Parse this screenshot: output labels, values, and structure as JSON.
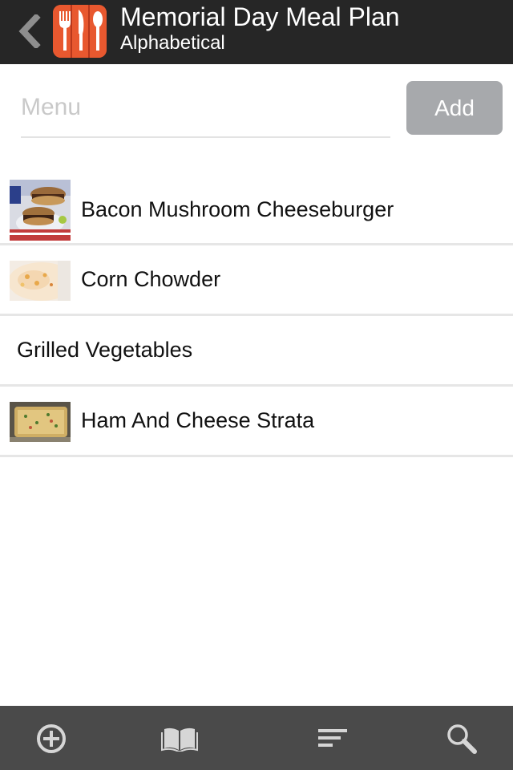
{
  "header": {
    "title": "Memorial Day Meal Plan",
    "subtitle": "Alphabetical",
    "back_icon": "chevron-left-icon",
    "logo_icon": "fork-knife-spoon-icon"
  },
  "menu_input": {
    "placeholder": "Menu",
    "value": ""
  },
  "add_button": {
    "label": "Add"
  },
  "items": [
    {
      "label": "Bacon Mushroom Cheeseburger",
      "has_image": true
    },
    {
      "label": "Corn Chowder",
      "has_image": true
    },
    {
      "label": "Grilled Vegetables",
      "has_image": false
    },
    {
      "label": "Ham And Cheese Strata",
      "has_image": true
    }
  ],
  "toolbar": {
    "icons": [
      "add-circle-icon",
      "book-icon",
      "sort-icon",
      "search-icon"
    ]
  },
  "colors": {
    "header_bg": "#262626",
    "toolbar_bg": "#4a4a4a",
    "add_button_bg": "#a7a9ac",
    "logo_accent": "#e8582f"
  }
}
